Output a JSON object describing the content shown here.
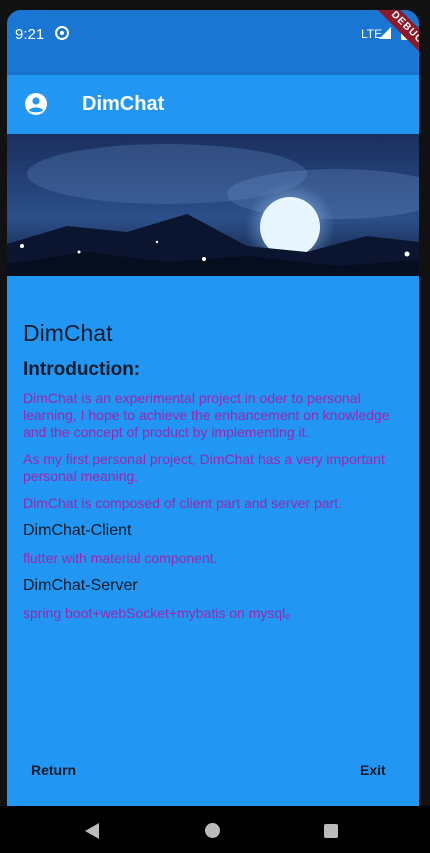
{
  "status": {
    "time": "9:21",
    "network": "LTE",
    "debug_label": "DEBUG"
  },
  "app_bar": {
    "title": "DimChat"
  },
  "content": {
    "title": "DimChat",
    "intro_heading": "Introduction:",
    "paragraph1": "DimChat is an experimental project in oder to personal learning, I hope to achieve the enhancement on knowledge and the concept of product by implementing it.",
    "paragraph2": "As my first personal project, DimChat has a very important personal meaning.",
    "paragraph3": "DimChat is composed of client part and server part.",
    "client_heading": "DimChat-Client",
    "client_text": "flutter with material component.",
    "server_heading": "DimChat-Server",
    "server_text": "spring boot+webSocket+mybatis on mysql。"
  },
  "actions": {
    "return_label": "Return",
    "exit_label": "Exit"
  },
  "colors": {
    "primary": "#2196F3",
    "primary_dark": "#1976D2",
    "accent_text": "#9C27B0"
  }
}
